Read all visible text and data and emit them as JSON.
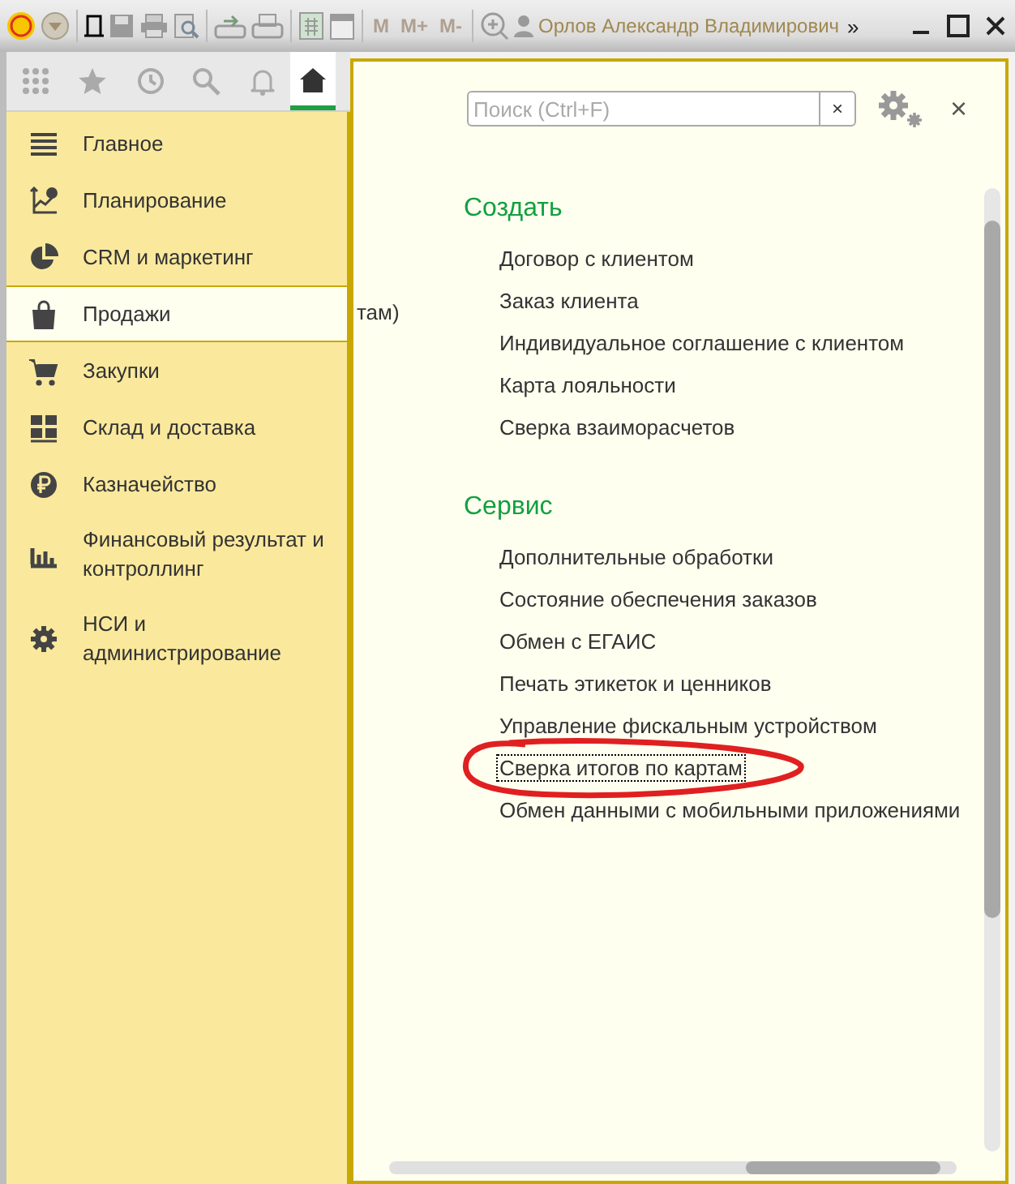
{
  "toolbar": {
    "memory_buttons": [
      "M",
      "M+",
      "M-"
    ],
    "user": "Орлов Александр Владимирович",
    "overflow": "»"
  },
  "nav_bar": {
    "icons": [
      {
        "kind": "grid"
      },
      {
        "kind": "star"
      },
      {
        "kind": "history"
      },
      {
        "kind": "search"
      },
      {
        "kind": "bell"
      },
      {
        "kind": "home",
        "selected": true
      }
    ]
  },
  "sidebar": {
    "items": [
      {
        "label": "Главное",
        "kind": "list",
        "selected": false
      },
      {
        "label": "Планирование",
        "kind": "chart-axes",
        "selected": false
      },
      {
        "label": "CRM и маркетинг",
        "kind": "pie",
        "selected": false
      },
      {
        "label": "Продажи",
        "kind": "bag",
        "selected": true
      },
      {
        "label": "Закупки",
        "kind": "cart",
        "selected": false
      },
      {
        "label": "Склад и доставка",
        "kind": "blocks",
        "selected": false
      },
      {
        "label": "Казначейство",
        "kind": "ruble",
        "selected": false
      },
      {
        "label": "Финансовый результат и контроллинг",
        "kind": "bars",
        "selected": false
      },
      {
        "label": "НСИ и администрирование",
        "kind": "gear",
        "selected": false
      }
    ]
  },
  "background_fragment": "там)",
  "panel": {
    "search": {
      "placeholder": "Поиск (Ctrl+F)",
      "clear": "×"
    },
    "close": "×",
    "groups": [
      {
        "title": "Создать",
        "links": [
          {
            "label": "Договор с клиентом",
            "focused": false
          },
          {
            "label": "Заказ клиента",
            "focused": false
          },
          {
            "label": "Индивидуальное соглашение с клиентом",
            "focused": false
          },
          {
            "label": "Карта лояльности",
            "focused": false
          },
          {
            "label": "Сверка взаиморасчетов",
            "focused": false
          }
        ]
      },
      {
        "title": "Сервис",
        "links": [
          {
            "label": "Дополнительные обработки",
            "focused": false
          },
          {
            "label": "Состояние обеспечения заказов",
            "focused": false
          },
          {
            "label": "Обмен с ЕГАИС",
            "focused": false
          },
          {
            "label": "Печать этикеток и ценников",
            "focused": false
          },
          {
            "label": "Управление фискальным устройством",
            "focused": false
          },
          {
            "label": "Сверка итогов по картам",
            "focused": true,
            "circled": true
          },
          {
            "label": "Обмен данными с мобильными приложениями",
            "focused": false
          }
        ]
      }
    ]
  }
}
